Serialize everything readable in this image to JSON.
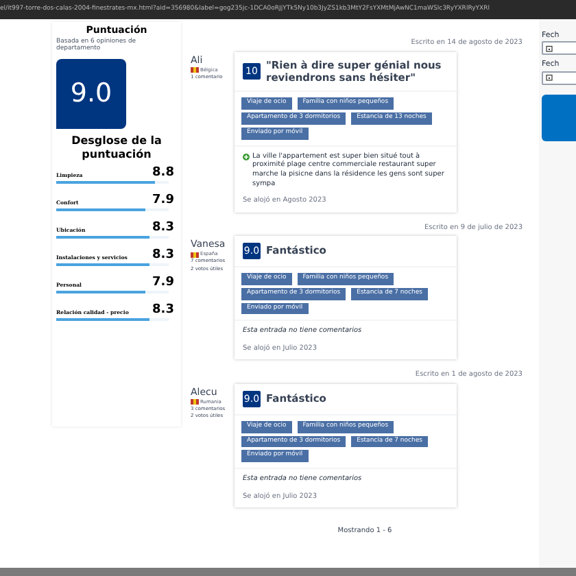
{
  "address_bar": {
    "url": "el/it997-torre-dos-calas-2004-finestrates-mx.html?aid=356980&label=gog235jc-1DCA0oRJjYTk5Ny10b3JyZS1kb3MtY2FsYXMtMjAwNC1maWSlc3RyYXRlRyYXRl"
  },
  "score_panel": {
    "title": "Puntuación",
    "subtitle": "Basada en 6 opiniones de departamento",
    "score": "9.0",
    "breakdown_title": "Desglose de la puntuación",
    "categories": [
      {
        "name": "Limpieza",
        "score": "8.8",
        "level": 0.88
      },
      {
        "name": "Confort",
        "score": "7.9",
        "level": 0.79
      },
      {
        "name": "Ubicación",
        "score": "8.3",
        "level": 0.83
      },
      {
        "name": "Instalaciones y servicios",
        "score": "8.3",
        "level": 0.83
      },
      {
        "name": "Personal",
        "score": "7.9",
        "level": 0.79
      },
      {
        "name": "Relación calidad - precio",
        "score": "8.3",
        "level": 0.83
      }
    ]
  },
  "reviews": [
    {
      "date": "Escrito en 14 de agosto de 2023",
      "name": "Ali",
      "country": "Bélgica",
      "stats": [
        "1 comentario"
      ],
      "score": "10",
      "title": "\"Rien à dire super génial nous reviendrons sans hésiter\"",
      "tags": [
        "Viaje de ocio",
        "Familia con niños pequeños",
        "Apartamento de 3 dormitorios",
        "Estancia de 13 noches",
        "Enviado por móvil"
      ],
      "kind": "comment",
      "comment": "La ville l'appartement est super bien situé tout à proximité plage centre commerciale restaurant super marche la pisicne dans la résidence les gens sont super sympa",
      "stay": "Se alojó en Agosto 2023"
    },
    {
      "date": "Escrito en 9 de julio de 2023",
      "name": "Vanesa",
      "country": "España",
      "stats": [
        "7 comentarios",
        "2 votos útiles"
      ],
      "score": "9.0",
      "title": "Fantástico",
      "tags": [
        "Viaje de ocio",
        "Familia con niños pequeños",
        "Apartamento de 3 dormitorios",
        "Estancia de 7 noches",
        "Enviado por móvil"
      ],
      "kind": "empty",
      "comment": "Esta entrada no tiene comentarios",
      "stay": "Se alojó en Julio 2023"
    },
    {
      "date": "Escrito en 1 de agosto de 2023",
      "name": "Alecu",
      "country": "Rumania",
      "stats": [
        "3 comentarios",
        "2 votos útiles"
      ],
      "score": "9.0",
      "title": "Fantástico",
      "tags": [
        "Viaje de ocio",
        "Familia con niños pequeños",
        "Apartamento de 3 dormitorios",
        "Estancia de 7 noches",
        "Enviado por móvil"
      ],
      "kind": "empty",
      "comment": "Esta entrada no tiene comentarios",
      "stay": "Se alojó en Julio 2023"
    }
  ],
  "pagination": "Mostrando 1 - 6",
  "sidebar": {
    "fields": [
      {
        "label": "Fech"
      },
      {
        "label": "Fech"
      }
    ]
  }
}
